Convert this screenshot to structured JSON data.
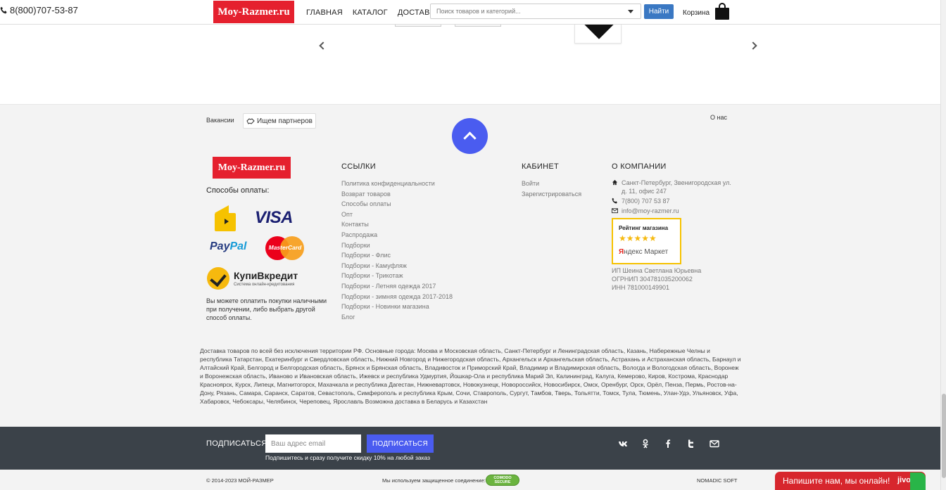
{
  "header": {
    "phone": "8(800)707-53-87",
    "logo": "Moy-Razmer.ru",
    "nav": [
      "ГЛАВНАЯ",
      "КАТАЛОГ",
      "ДОСТАВКА"
    ],
    "search_placeholder": "Поиск товаров и категорий...",
    "search_button": "Найти",
    "cart_label": "Корзина"
  },
  "strip": {
    "vacancies": "Вакансии",
    "partners": "Ищем партнеров",
    "about": "О нас"
  },
  "footer": {
    "logo": "Moy-Razmer.ru",
    "payment_title": "Способы оплаты:",
    "payments": {
      "visa": "VISA",
      "paypal_a": "Pay",
      "paypal_b": "Pal",
      "mastercard": "MasterCard",
      "kupi_title": "КупиВкредит",
      "kupi_sub": "Система онлайн-кредитования"
    },
    "payment_note": "Вы можете оплатить покупки наличными при получении, либо выбрать другой способ оплаты.",
    "links_title": "ССЫЛКИ",
    "links": [
      "Политика конфиденциальности",
      "Возврат товаров",
      "Способы оплаты",
      "Опт",
      "Контакты",
      "Распродажа",
      "Подборки",
      "Подборки - Флис",
      "Подборки - Камуфляж",
      "Подборки - Трикотаж",
      "Подборки - Летняя одежда 2017",
      "Подборки - зимняя одежда 2017-2018",
      "Подборки - Новинки магазина",
      "Блог"
    ],
    "cabinet_title": "КАБИНЕТ",
    "cabinet": [
      "Войти",
      "Зарегистрироваться"
    ],
    "company_title": "О КОМПАНИИ",
    "company": {
      "address": "Санкт-Петербург, Звенигородская ул. д. 11, офис 247",
      "phone": "7(800) 707 53 87",
      "email": "info@moy-razmer.ru"
    },
    "rating": {
      "title": "Рейтинг магазина",
      "stars": "★★★★★",
      "market_a": "Я",
      "market_b": "ндекс Маркет"
    },
    "legal": [
      "ИП Шеина Светлана Юрьевна",
      "ОГРНИП 304781035200062",
      "ИНН 781000149901"
    ],
    "delivery": "Доставка товаров по всей без исключения территории РФ. Основные города: Москва и Московская область, Санкт-Петербург и Ленинградская область, Казань, Набережные Челны и республика Татарстан, Екатеринбург и Свердловская область, Нижний Новгород и Нижегородская область, Архангельск и Архангельская область, Астрахань и Астраханская область, Барнаул и Алтайский Край, Белгород и Белгородская область, Брянск и Брянская область, Владивосток и Приморский Край, Владимир и Владимирская область, Вологда и Вологодская область, Воронеж и Воронежская область, Иваново и Ивановская область, Ижевск и республика Удмуртия, Йошкар-Ола и республика Марий Эл, Калининград, Калуга, Кемерово, Киров, Кострома, Краснодар Красноярск, Курск, Липецк, Магнитогорск, Махачкала и республика Дагестан, Нижневартовск, Новокузнецк, Новороссийск, Новосибирск, Омск, Оренбург, Орск, Орёл, Пенза, Пермь, Ростов-на-Дону, Рязань, Самара, Саранск, Саратов, Севастополь, Симферополь и республика Крым, Сочи, Ставрополь, Сургут, Тамбов, Тверь, Тольятти, Томск, Тула, Тюмень, Улан-Удэ, Ульяновск, Уфа, Хабаровск, Чебоксары, Челябинск, Череповец, Ярославль Возможна доставка в Беларусь и Казахстан"
  },
  "subscribe": {
    "label": "ПОДПИСАТЬСЯ",
    "placeholder": "Ваш адрес email",
    "button": "ПОДПИСАТЬСЯ",
    "hint": "Подпишитесь и сразу получите скидку 10% на любой заказ"
  },
  "bottom": {
    "copyright": "© 2014-2023 МОЙ-РАЗМЕР",
    "secure": "Мы используем защищенное соединение:",
    "comodo": "COMODO SECURE",
    "nomadic": "NOMADIC SOFT"
  },
  "chat": {
    "message": "Напишите нам, мы онлайн!",
    "brand": "jivo"
  },
  "colors": {
    "brand_red": "#e5202e",
    "accent_blue": "#4a5cf0",
    "dark_bar": "#3b4249",
    "chat_red": "#d7262d"
  }
}
